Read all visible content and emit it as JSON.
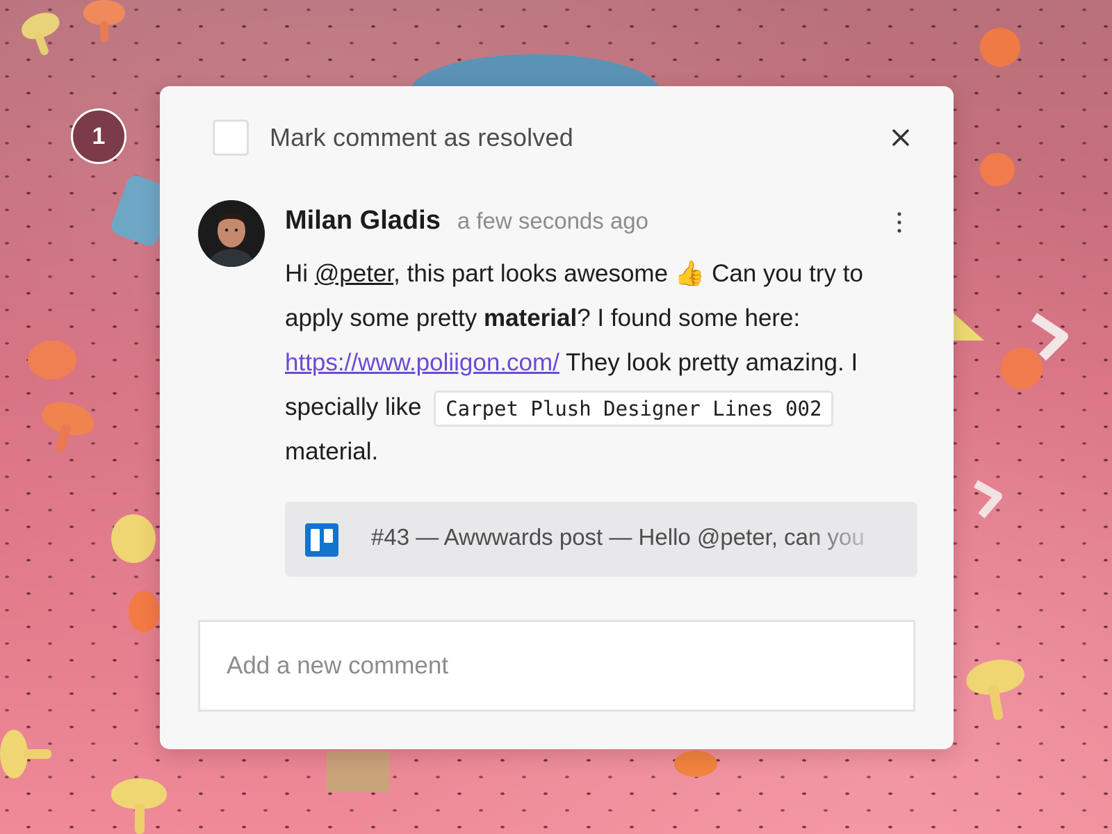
{
  "step_badge": "1",
  "resolve": {
    "label": "Mark comment as resolved",
    "checked": false
  },
  "comment": {
    "author": "Milan Gladis",
    "time": "a few seconds ago",
    "body": {
      "hi": "Hi ",
      "mention": "@peter",
      "text1": ", this part looks awesome ",
      "emoji": "👍",
      "text2": " Can you try to apply some pretty ",
      "bold": "material",
      "text3": "? I found some here: ",
      "link": "https://www.poliigon.com/",
      "text4": " They look pretty amazing. I specially like ",
      "code": "Carpet Plush Designer Lines 002",
      "text5": " material."
    }
  },
  "trello": {
    "text": "#43 — Awwwards post — Hello @peter, can you"
  },
  "new_comment": {
    "placeholder": "Add a new comment",
    "value": ""
  },
  "colors": {
    "accent_link": "#6a4bd6",
    "trello_blue": "#1174cf",
    "badge": "#7b3b48"
  }
}
